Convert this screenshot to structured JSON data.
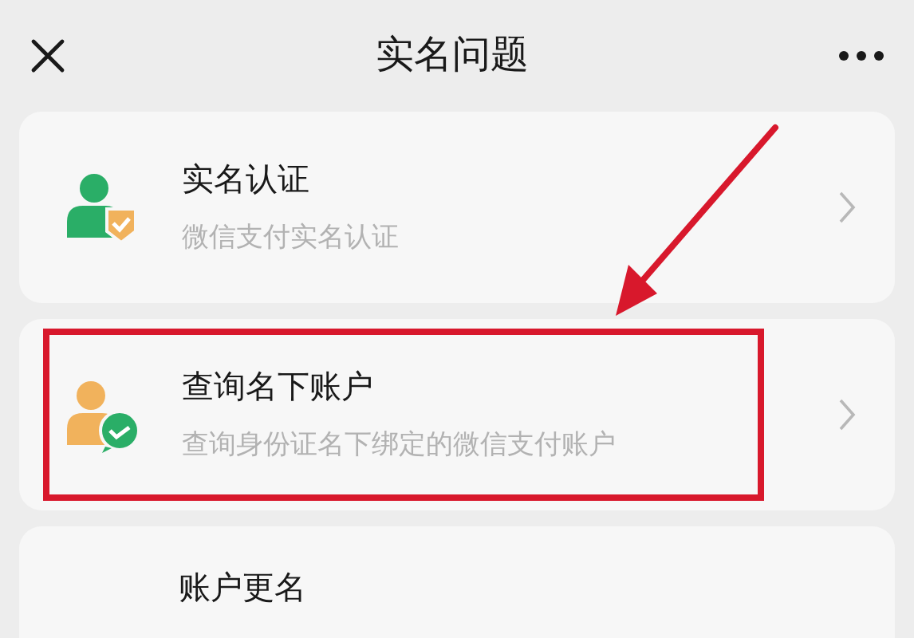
{
  "header": {
    "title": "实名问题"
  },
  "items": [
    {
      "kind": "verify",
      "title": "实名认证",
      "subtitle": "微信支付实名认证",
      "highlighted": false
    },
    {
      "kind": "accounts",
      "title": "查询名下账户",
      "subtitle": "查询身份证名下绑定的微信支付账户",
      "highlighted": true
    },
    {
      "kind": "rename",
      "title": "账户更名",
      "highlighted": false
    }
  ]
}
